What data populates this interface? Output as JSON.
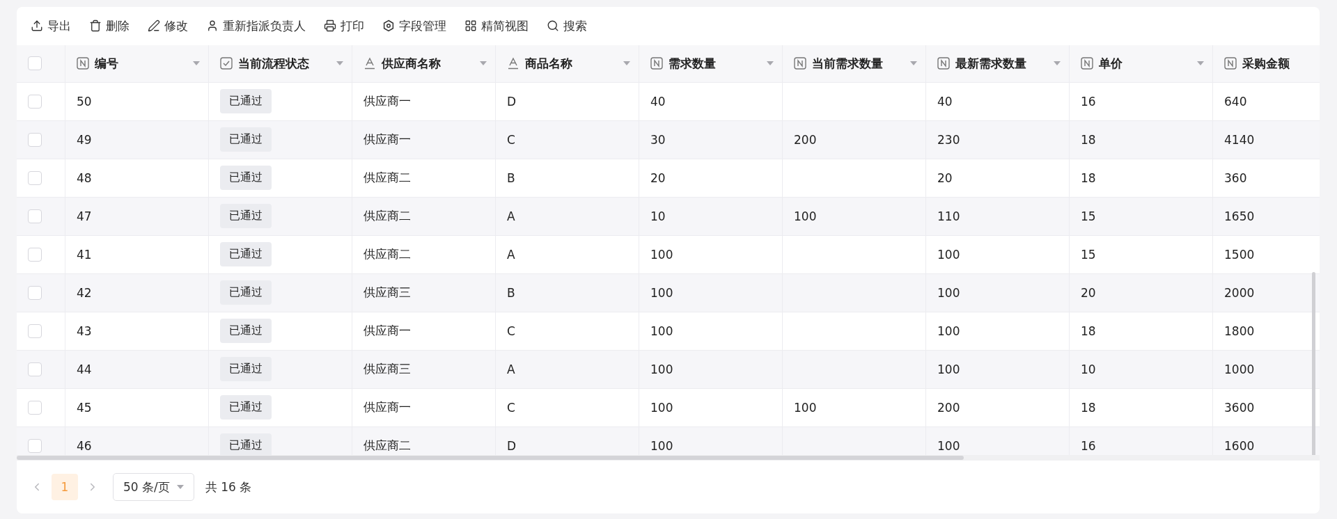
{
  "toolbar": [
    {
      "label": "导出"
    },
    {
      "label": "删除"
    },
    {
      "label": "修改"
    },
    {
      "label": "重新指派负责人"
    },
    {
      "label": "打印"
    },
    {
      "label": "字段管理"
    },
    {
      "label": "精简视图"
    },
    {
      "label": "搜索"
    }
  ],
  "table": {
    "all_checked": false,
    "columns": [
      {
        "label": "编号",
        "kind": "number",
        "sortable": true
      },
      {
        "label": "当前流程状态",
        "kind": "status",
        "sortable": true
      },
      {
        "label": "供应商名称",
        "kind": "text",
        "sortable": true
      },
      {
        "label": "商品名称",
        "kind": "text",
        "sortable": true
      },
      {
        "label": "需求数量",
        "kind": "number",
        "sortable": true
      },
      {
        "label": "当前需求数量",
        "kind": "number",
        "sortable": true
      },
      {
        "label": "最新需求数量",
        "kind": "number",
        "sortable": true
      },
      {
        "label": "单价",
        "kind": "number",
        "sortable": true
      },
      {
        "label": "采购金额",
        "kind": "number",
        "sortable": false
      }
    ],
    "rows": [
      {
        "checked": false,
        "cells": [
          "50",
          "已通过",
          "供应商一",
          "D",
          "40",
          "",
          "40",
          "16",
          "640"
        ]
      },
      {
        "checked": false,
        "cells": [
          "49",
          "已通过",
          "供应商一",
          "C",
          "30",
          "200",
          "230",
          "18",
          "4140"
        ]
      },
      {
        "checked": false,
        "cells": [
          "48",
          "已通过",
          "供应商二",
          "B",
          "20",
          "",
          "20",
          "18",
          "360"
        ]
      },
      {
        "checked": false,
        "cells": [
          "47",
          "已通过",
          "供应商二",
          "A",
          "10",
          "100",
          "110",
          "15",
          "1650"
        ]
      },
      {
        "checked": false,
        "cells": [
          "41",
          "已通过",
          "供应商二",
          "A",
          "100",
          "",
          "100",
          "15",
          "1500"
        ]
      },
      {
        "checked": false,
        "cells": [
          "42",
          "已通过",
          "供应商三",
          "B",
          "100",
          "",
          "100",
          "20",
          "2000"
        ]
      },
      {
        "checked": false,
        "cells": [
          "43",
          "已通过",
          "供应商一",
          "C",
          "100",
          "",
          "100",
          "18",
          "1800"
        ]
      },
      {
        "checked": false,
        "cells": [
          "44",
          "已通过",
          "供应商三",
          "A",
          "100",
          "",
          "100",
          "10",
          "1000"
        ]
      },
      {
        "checked": false,
        "cells": [
          "45",
          "已通过",
          "供应商一",
          "C",
          "100",
          "100",
          "200",
          "18",
          "3600"
        ]
      },
      {
        "checked": false,
        "cells": [
          "46",
          "已通过",
          "供应商二",
          "D",
          "100",
          "",
          "100",
          "16",
          "1600"
        ]
      }
    ]
  },
  "pagination": {
    "pages": [
      {
        "label": "1",
        "selected": true
      }
    ],
    "page_size": "50 条/页",
    "total": "共 16 条"
  }
}
